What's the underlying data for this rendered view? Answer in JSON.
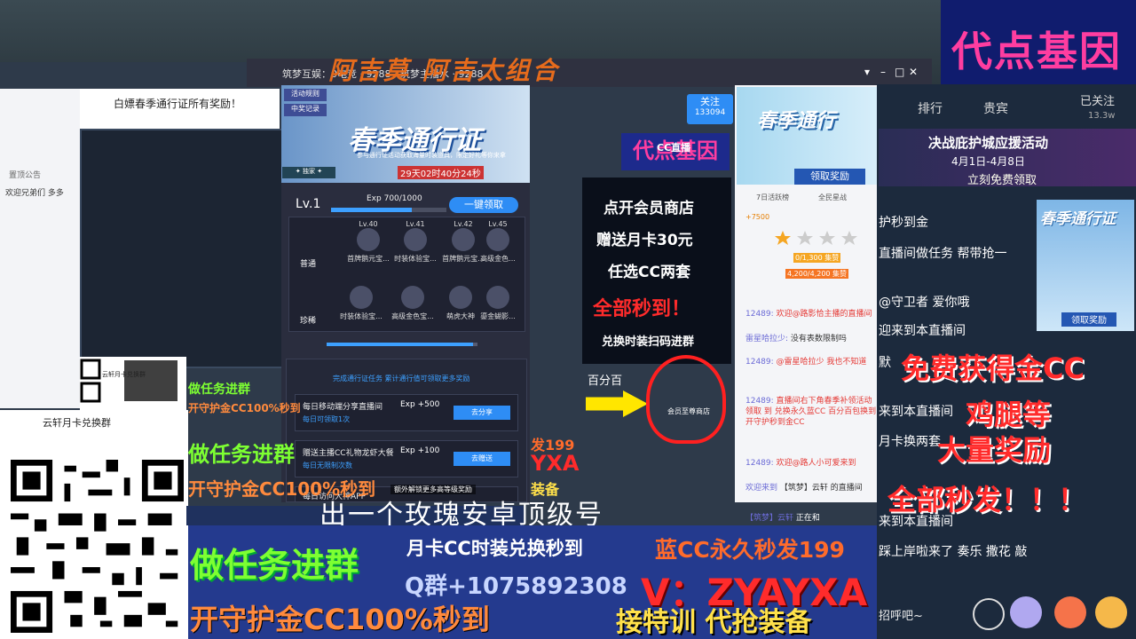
{
  "brand": {
    "title": "代点基因"
  },
  "watermark": {
    "top": "阿吉莫 阿吉太组合",
    "mid": "出一个玫瑰安卓顶级号"
  },
  "app": {
    "title": "筑梦互娱：0电竞 · 9288 · 筑梦主播水 · 9288",
    "follow_label": "关注",
    "follow_count": "133094",
    "window_controls": [
      "▾",
      "–",
      "□",
      "✕"
    ]
  },
  "left": {
    "notice_label": "置顶公告",
    "welcome": "欢迎兄弟们 多多",
    "pin_notice": "白嫖春季通行证所有奖励！",
    "qr_small_label": "云轩月卡兑换群",
    "qr_big_label": "云轩月卡兑换群"
  },
  "pass": {
    "activity": "活动规则",
    "prize": "中奖记录",
    "heading": "春季通行证",
    "subtitle": "参与通行证活动获取海量时装道具，限定好礼等你来拿",
    "countdown": "29天02时40分24秒",
    "badge": "✦ 独家 ✦",
    "level": "Lv.1",
    "exp": "Exp 700/1000",
    "exp_ratio": 0.7,
    "claim_all": "一键领取",
    "row_normal": "普通",
    "row_rare": "珍稀",
    "rewards_top": [
      {
        "lv": "Lv.40",
        "name": "首牌鹅元宝..."
      },
      {
        "lv": "Lv.41",
        "name": "时装体验宝..."
      },
      {
        "lv": "Lv.42",
        "name": "首牌鹅元宝..."
      },
      {
        "lv": "Lv.45",
        "name": "高级金色..."
      }
    ],
    "rewards_bottom": [
      {
        "name": "时装体验宝..."
      },
      {
        "name": "高级金色宝..."
      },
      {
        "name": "萌虎大神"
      },
      {
        "name": "鎏金蝴影..."
      }
    ],
    "scroll_ratio": 0.97,
    "tasks_intro": "完成通行证任务 累计通行值可领取更多奖励",
    "tasks": [
      {
        "title": "每日移动端分享直播间",
        "sub": "每日可领取1次",
        "exp": "Exp +500",
        "btn": "去分享"
      },
      {
        "title": "赠送主播CC礼物龙虾大餐",
        "sub": "每日无限制次数",
        "exp": "Exp +100",
        "btn": "去赠送"
      },
      {
        "title": "每日访问大神APP",
        "sub": "",
        "exp": "",
        "btn": ""
      }
    ],
    "unlock_hint": "额外解锁更多高等级奖励"
  },
  "ad": {
    "brand": "代点基因",
    "cc_logo": "CC直播",
    "line1": "点开会员商店",
    "line2": "赠送月卡30元",
    "line3": "任选CC两套",
    "line4": "全部秒到！",
    "line5": "兑换时装扫码进群",
    "stat": "百分百",
    "gift_label": "会员至尊商店"
  },
  "rank_panel": {
    "banner": "春季通行",
    "claim": "领取奖励",
    "tabs": [
      "7日活跃榜",
      "全民星战"
    ],
    "coin": "+7500",
    "progress1": "0/1,300 集赞",
    "progress2": "4,200/4,200 集赞",
    "chat": [
      {
        "nm": "12489:",
        "text": "欢迎@路影恰主播的直播间"
      },
      {
        "nm": "雷星哈拉少:",
        "text": "没有表数限制吗"
      },
      {
        "nm": "12489:",
        "text": "@雷星哈拉少 我也不知道"
      },
      {
        "nm": "12489:",
        "text": "直播间右下角春季补领活动领取 到 兑换永久蓝CC 百分百包换到 开守护秒到金CC"
      },
      {
        "nm": "12489:",
        "text": "欢迎@路人小可爱来到"
      },
      {
        "nm": "欢迎来到",
        "text": "【筑梦】云轩 的直播间"
      },
      {
        "nm": "【筑梦】云轩",
        "text": "正在和"
      }
    ]
  },
  "right": {
    "tab_rank": "排行",
    "tab_vip": "贵宾",
    "followed": "已关注",
    "followed_count": "13.3w",
    "event_title": "决战庇护城应援活动",
    "event_dates": "4月1日-4月8日",
    "event_claim": "立刻免费领取",
    "pass_title": "春季通行证",
    "pass_claim": "领取奖励",
    "lines": [
      "护秒到金",
      "直播间做任务 帮带抢一",
      "@守卫者 爱你哦",
      "迎来到本直播间",
      "默",
      "来到本直播间",
      "月卡换两套",
      "来到本直播间",
      "踩上岸啦来了 奏乐 撒花 敲"
    ],
    "promo1": "免费获得金CC",
    "promo2": "鸡腿等",
    "promo3": "大量奖励",
    "promo4": "全部秒发！！！",
    "greet": "招呼吧~"
  },
  "bottom": {
    "tasks": "做任务进群",
    "guard": "开守护金CC100%秒到",
    "monthly": "月卡CC时装兑换秒到",
    "blue_cc": "蓝CC永久秒发199",
    "qq": "Q群+1075892308",
    "wechat": "V：ZYAYXA",
    "training": "接特训 代抢装备"
  },
  "mid": {
    "yxa": "YXA",
    "p199": "发199",
    "equip": "装备"
  },
  "colors": {
    "accent_blue": "#2e8df5",
    "promo_red": "#ff2b2b",
    "promo_green": "#7dff32",
    "brand_pink": "#ff3da0"
  }
}
